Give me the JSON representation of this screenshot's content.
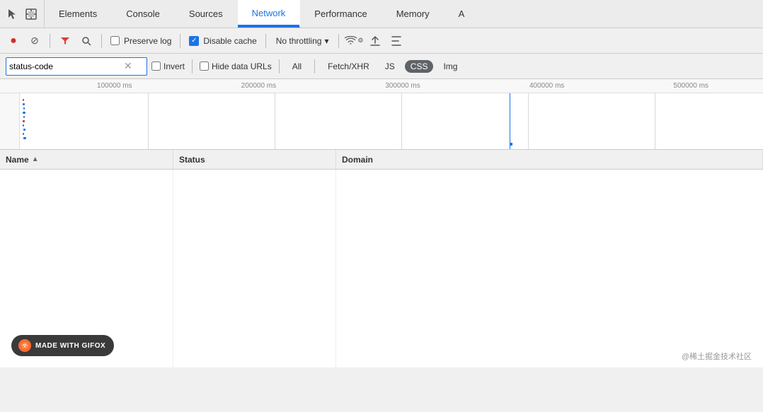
{
  "nav": {
    "tabs": [
      {
        "label": "Elements",
        "active": false
      },
      {
        "label": "Console",
        "active": false
      },
      {
        "label": "Sources",
        "active": false
      },
      {
        "label": "Network",
        "active": true
      },
      {
        "label": "Performance",
        "active": false
      },
      {
        "label": "Memory",
        "active": false
      },
      {
        "label": "A",
        "active": false
      }
    ]
  },
  "toolbar": {
    "record_label": "●",
    "stop_label": "⊘",
    "filter_label": "▼",
    "search_label": "🔍",
    "preserve_log": "Preserve log",
    "disable_cache": "Disable cache",
    "no_throttling": "No throttling",
    "throttle_arrow": "▾"
  },
  "filter": {
    "search_value": "status-code",
    "invert_label": "Invert",
    "hide_data_urls_label": "Hide data URLs",
    "filter_buttons": [
      {
        "label": "All",
        "active": false
      },
      {
        "label": "Fetch/XHR",
        "active": false
      },
      {
        "label": "JS",
        "active": false
      },
      {
        "label": "CSS",
        "active": true
      },
      {
        "label": "Img",
        "active": false
      }
    ]
  },
  "timeline": {
    "ruler_marks": [
      "100000 ms",
      "200000 ms",
      "300000 ms",
      "400000 ms",
      "500000 ms"
    ]
  },
  "table": {
    "columns": [
      {
        "label": "Name",
        "sort_arrow": "▲"
      },
      {
        "label": "Status"
      },
      {
        "label": "Domain"
      }
    ]
  },
  "badge": {
    "text": "MADE WITH GIFOX"
  },
  "watermark": {
    "text": "@稀土掘金技术社区"
  },
  "icons": {
    "cursor": "↖",
    "inspect": "⬜",
    "wifi": "📶",
    "upload": "⬆"
  }
}
